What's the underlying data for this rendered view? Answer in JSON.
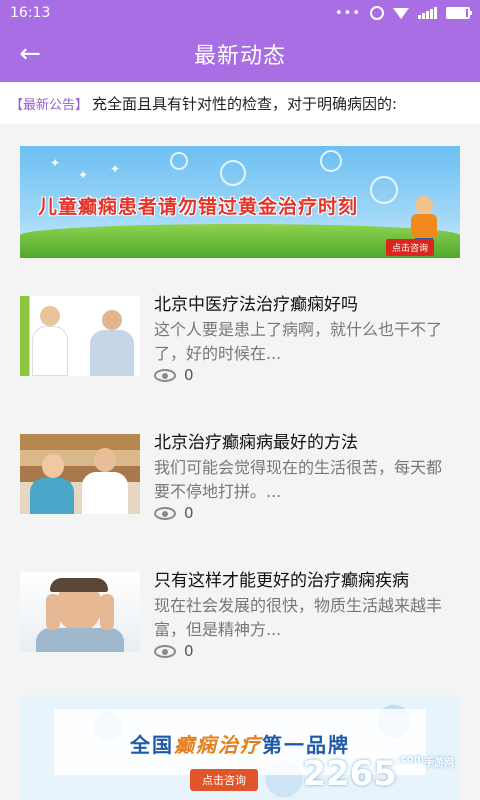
{
  "status_bar": {
    "time": "16:13",
    "battery_percent": 90
  },
  "app_bar": {
    "back_icon": "←",
    "title": "最新动态"
  },
  "notice": {
    "tag": "【最新公告】",
    "text": "充全面且具有针对性的检查，对于明确病因的:"
  },
  "banner_top": {
    "headline": "儿童癫痫患者请勿错过黄金治疗时刻",
    "button": "点击咨询"
  },
  "news": [
    {
      "title": "北京中医疗法治疗癫痫好吗",
      "summary": "这个人要是患上了病啊，就什么也干不了了，好的时候在...",
      "views": "0"
    },
    {
      "title": "北京治疗癫痫病最好的方法",
      "summary": "我们可能会觉得现在的生活很苦，每天都要不停地打拼。...",
      "views": "0"
    },
    {
      "title": "只有这样才能更好的治疗癫痫疾病",
      "summary": "现在社会发展的很快，物质生活越来越丰富，但是精神方...",
      "views": "0"
    }
  ],
  "banner_bottom": {
    "title_part1": "全国",
    "title_part2": "癫痫治疗",
    "title_part3": "第一品牌",
    "button": "点击咨询"
  },
  "watermark": {
    "text": "2265",
    "suffix": ".com",
    "subtext": "手游网"
  }
}
